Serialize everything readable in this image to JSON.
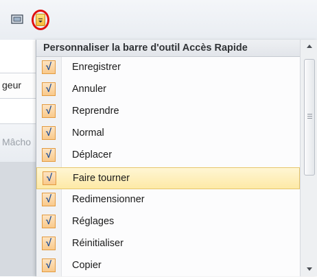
{
  "toolbar": {
    "icons": [
      "window-frame-icon",
      "qat-dropdown-icon"
    ],
    "highlight_color": "#e00f0f"
  },
  "background": {
    "field_text": "geur",
    "muted_text": "Mâcho"
  },
  "menu": {
    "title": "Personnaliser la barre d'outil Accès Rapide",
    "check_glyph": "√",
    "items": [
      {
        "label": "Enregistrer",
        "checked": true
      },
      {
        "label": "Annuler",
        "checked": true
      },
      {
        "label": "Reprendre",
        "checked": true
      },
      {
        "label": "Normal",
        "checked": true
      },
      {
        "label": "Déplacer",
        "checked": true
      },
      {
        "label": "Faire tourner",
        "checked": true,
        "highlighted": true
      },
      {
        "label": "Redimensionner",
        "checked": true
      },
      {
        "label": "Réglages",
        "checked": true
      },
      {
        "label": "Réinitialiser",
        "checked": true
      },
      {
        "label": "Copier",
        "checked": true
      }
    ]
  },
  "colors": {
    "check_bg": "#f9c98a",
    "check_border": "#e39a3e",
    "highlight_bg": "#fde9a6"
  }
}
